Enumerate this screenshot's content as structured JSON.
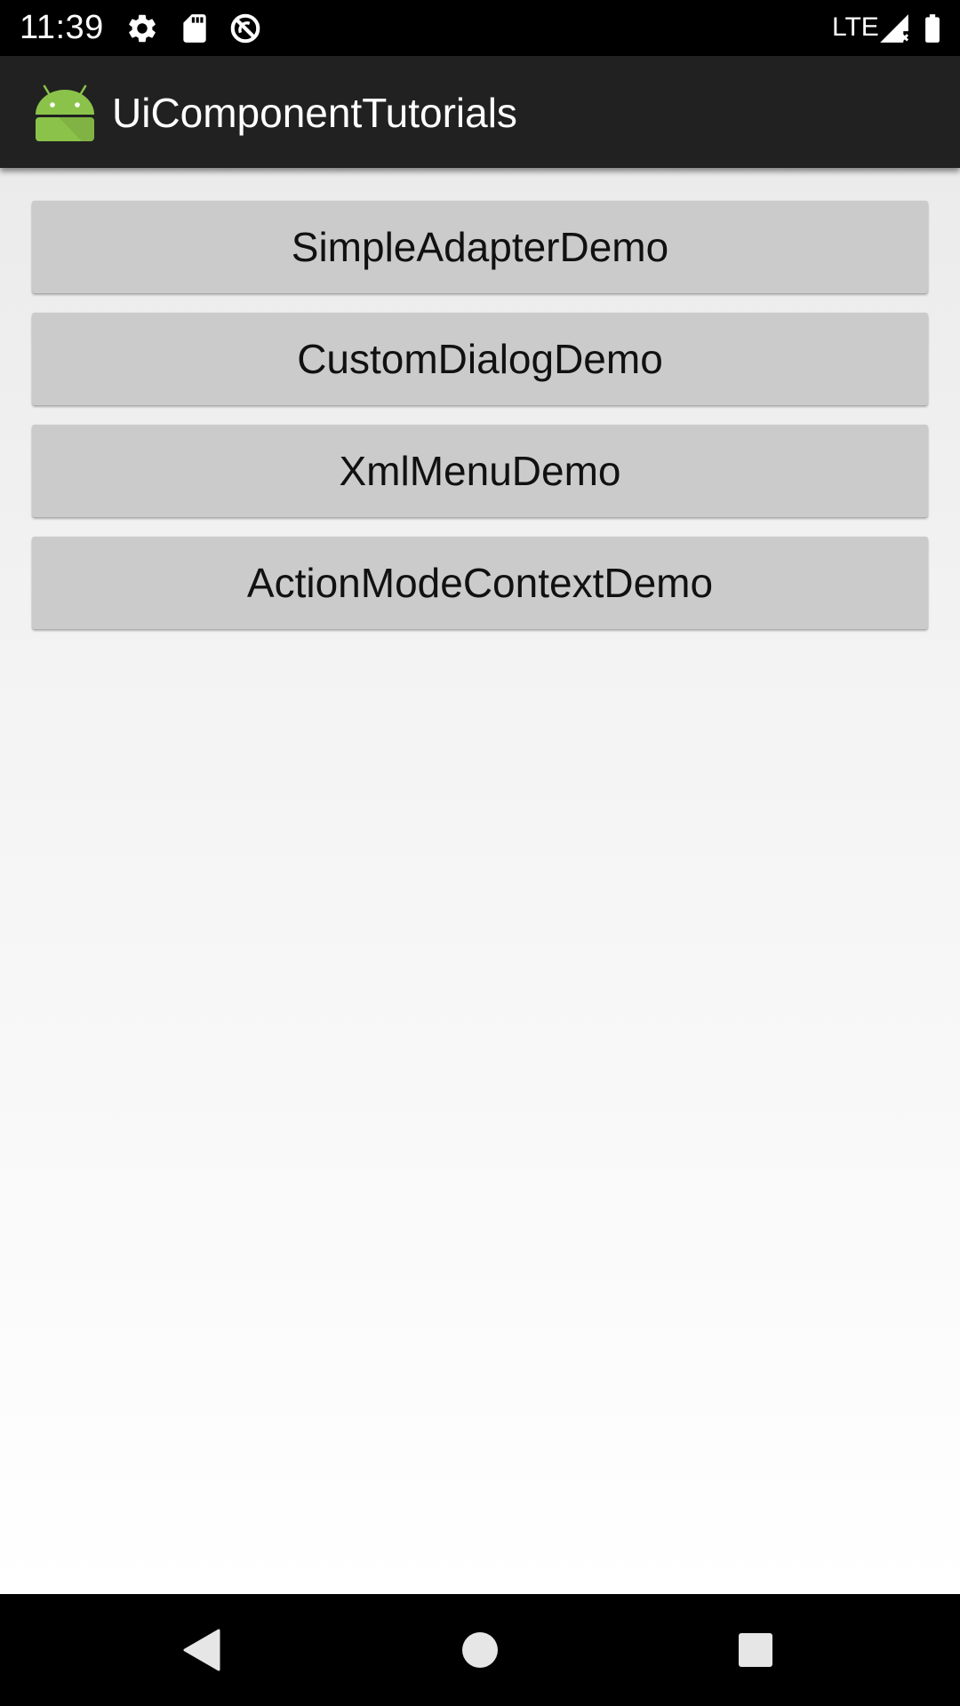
{
  "status_bar": {
    "time": "11:39",
    "network": "LTE",
    "icons": [
      "settings-icon",
      "sd-card-icon",
      "data-saver-icon",
      "signal-icon",
      "battery-icon"
    ]
  },
  "app_bar": {
    "title": "UiComponentTutorials",
    "logo_icon": "android-icon",
    "logo_color": "#8BC34A"
  },
  "buttons": [
    {
      "label": "SimpleAdapterDemo"
    },
    {
      "label": "CustomDialogDemo"
    },
    {
      "label": "XmlMenuDemo"
    },
    {
      "label": "ActionModeContextDemo"
    }
  ],
  "nav_bar": {
    "icons": [
      "back-icon",
      "home-icon",
      "recents-icon"
    ]
  }
}
